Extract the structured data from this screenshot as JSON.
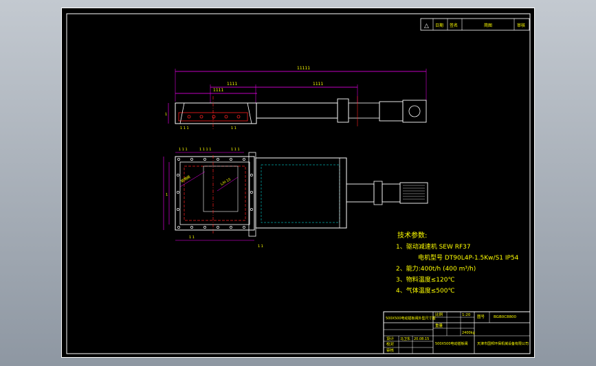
{
  "drawing": {
    "revision_header": {
      "mark": "△",
      "cells": [
        "日期",
        "签名",
        "简图",
        "审核"
      ]
    },
    "tech_requirements": {
      "title": "技术参数:",
      "lines": [
        "1、驱动减速机 SEW  RF37",
        "电机型号  DT90L4P-1.5Kw/S1  IP54",
        "2、能力:400t/h (400 m³/h)",
        "3、物料温度≤120℃",
        "4、气体温度≤500℃"
      ]
    },
    "title_block": {
      "drawing_title": "500X500电动插板阀外型尺寸图",
      "scale_label": "比例",
      "scale_value": "1:20",
      "drawing_no_label": "图号",
      "drawing_no": "BGB0C8800",
      "weight_label": "重量",
      "weight_value": "2400kg",
      "rows": [
        "设计",
        "校对",
        "审核"
      ],
      "designer": "马卫东",
      "date": "20.08.15",
      "product": "500X500电动插板阀",
      "company": "天津市国邦环保机械设备有限公司"
    },
    "annotations": {
      "top_dims": [
        "1111",
        "1111",
        "1111",
        "11111"
      ],
      "plan_label_1": "说明阀",
      "plan_label_2": "L/H 15"
    },
    "colors": {
      "sheet_bg": "#000000",
      "line": "#ffffff",
      "text": "#ffff00",
      "dim": "#ff00ff",
      "center": "#ff2020",
      "hidden": "#00ffff"
    }
  }
}
